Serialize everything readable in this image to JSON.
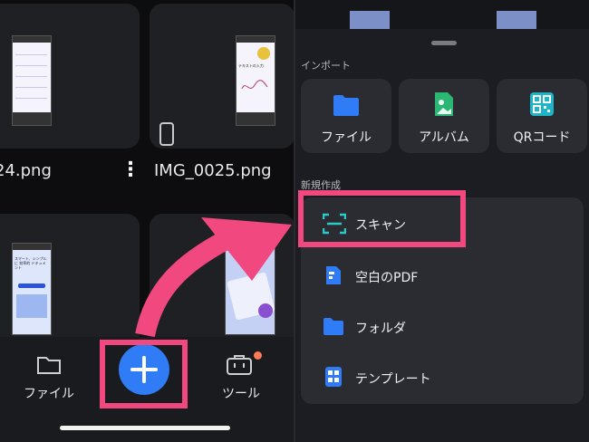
{
  "left_screen": {
    "files": [
      {
        "name": "24.png"
      },
      {
        "name": "IMG_0025.png"
      }
    ],
    "thumb_texts": {
      "text_input_note": "テキストの入力",
      "promo_title": "スマート、シンプルに 効率的 ドキュメント",
      "promo_header": "へようこそ"
    },
    "bottom_nav": {
      "files_label": "ファイル",
      "tools_label": "ツール",
      "add_symbol": "+"
    }
  },
  "right_screen": {
    "import_section": {
      "title": "インポート",
      "items": [
        {
          "label": "ファイル",
          "icon": "folder-icon"
        },
        {
          "label": "アルバム",
          "icon": "photo-icon"
        },
        {
          "label": "QRコード",
          "icon": "qr-code-icon"
        }
      ]
    },
    "new_section": {
      "title": "新規作成",
      "items": [
        {
          "label": "スキャン",
          "icon": "scan-icon"
        },
        {
          "label": "空白のPDF",
          "icon": "blank-pdf-icon"
        },
        {
          "label": "フォルダ",
          "icon": "folder-icon"
        },
        {
          "label": "テンプレート",
          "icon": "template-icon"
        }
      ]
    }
  },
  "colors": {
    "highlight": "#f0487f",
    "fab_blue": "#2f7cf6",
    "folder_blue": "#2f7cf6",
    "album_green": "#2bb673",
    "qr_teal": "#1fb5c9",
    "scan_teal": "#2cc9c9",
    "notification_dot": "#ff7a59"
  }
}
